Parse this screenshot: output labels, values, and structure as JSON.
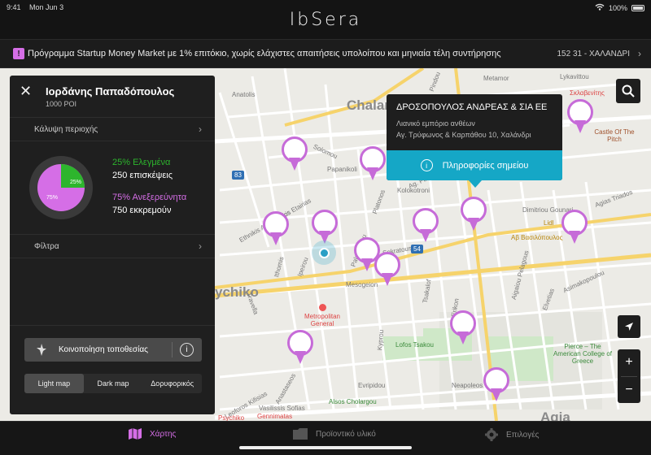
{
  "status": {
    "time": "9:41",
    "date": "Mon Jun 3",
    "battery": "100%"
  },
  "app": {
    "brand": "IbSera"
  },
  "notice": {
    "text": "Πρόγραμμα Startup Money Market με 1% επιτόκιο, χωρίς ελάχιστες απαιτήσεις υπολοίπου και μηνιαία τέλη συντήρησης",
    "location": "152 31 - ΧΑΛΑΝΔΡΙ"
  },
  "panel": {
    "title": "Ιορδάνης Παπαδόπουλος",
    "subtitle": "1000 POI",
    "coverage_label": "Κάλυψη περιοχής",
    "filters_label": "Φίλτρα",
    "checked_label": "25% Ελεγμένα",
    "checked_value": "250 επισκέψεις",
    "unexplored_label": "75% Ανεξερεύνητα",
    "unexplored_value": "750 εκκρεμούν",
    "donut_checked_pct": "25%",
    "donut_unexplored_pct": "75%",
    "donut_checked_fraction": 0.25,
    "share_label": "Κοινοποίηση τοποθεσίας",
    "map_types": [
      "Light map",
      "Dark map",
      "Δορυφορικός"
    ],
    "map_type_selected": "Light map"
  },
  "popup": {
    "name": "ΔΡΟΣΟΠΟΥΛΟΣ ΑΝΔΡΕΑΣ & ΣΙΑ ΕΕ",
    "category": "Λιανικό εμπόριο ανθέων",
    "address": "Αγ. Τρύφωνος & Καρπάθου 10, Χαλάνδρι",
    "button_label": "Πληροφορίες σημείου"
  },
  "map": {
    "districts": [
      "Chalan",
      "ychiko",
      "Agia"
    ],
    "streets": [
      "Anatolis",
      "Filikis Etairias",
      "Ethnikis Antistaseos",
      "Ipeirou",
      "Ithomis",
      "Mesogeion",
      "Papanikoli",
      "Solomou",
      "Kolokotroni",
      "Evripidou",
      "Neapoleos",
      "Agias Triados",
      "Dimitriou Gounari",
      "Asimakopoulou",
      "Elvetias",
      "Aigaiou Pelagous",
      "Travella",
      "Leoforos Kifisias",
      "Anastaseos",
      "Vasilissis Sofias",
      "Ag. Paraskevis",
      "Platonos",
      "Pindou",
      "Erikon",
      "Metamor",
      "Sokratous",
      "Palaiologou",
      "Tsakalof",
      "Kyprou",
      "Lykavittou"
    ],
    "places": [
      "Metropolitan General",
      "Lofos Tsakou",
      "Alsos Cholargou",
      "Pierce – The American College of Greece",
      "Lidl",
      "Αβ Βασιλόπουλος",
      "Castle Of The Pitch",
      "Σκλαβενίτης",
      "Psychiko",
      "Gennimatas"
    ],
    "road_badges": [
      "83",
      "54"
    ],
    "pin_count": 17
  },
  "tabs": [
    {
      "label": "Χάρτης",
      "active": true
    },
    {
      "label": "Προϊοντικό υλικό",
      "active": false
    },
    {
      "label": "Επιλογές",
      "active": false
    }
  ],
  "colors": {
    "accent": "#d56ee6",
    "checked": "#2db52d",
    "info": "#15a7c6",
    "panel": "#1f1f1f"
  }
}
